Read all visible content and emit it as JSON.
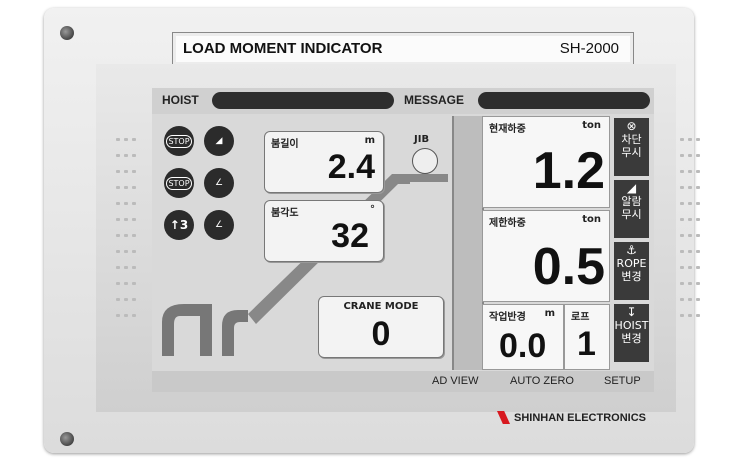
{
  "device": {
    "title": "LOAD MOMENT INDICATOR",
    "model": "SH-2000",
    "brand": "SHINHAN ELECTRONICS",
    "brand_color": "#d71920"
  },
  "topbar": {
    "hoist_label": "HOIST",
    "message_label": "MESSAGE"
  },
  "indicators": {
    "icons": [
      "stop-sign-icon",
      "boom-icon",
      "stop-overload-icon",
      "boom-angle-icon",
      "hook-up-icon",
      "boom-angle-down-icon"
    ],
    "stop_text": "STOP",
    "hook_text": "↑3"
  },
  "boom_length": {
    "label": "붐길이",
    "unit": "m",
    "value": "2.4"
  },
  "boom_angle": {
    "label": "붐각도",
    "unit": "°",
    "value": "32"
  },
  "jib": {
    "label": "JIB"
  },
  "crane_mode": {
    "label": "CRANE MODE",
    "value": "0"
  },
  "current_load": {
    "label": "현재하중",
    "unit": "ton",
    "value": "1.2"
  },
  "rated_load": {
    "label": "제한하중",
    "unit": "ton",
    "value": "0.5"
  },
  "working_radius": {
    "label": "작업반경",
    "unit": "m",
    "value": "0.0"
  },
  "rope": {
    "label": "로프",
    "value": "1"
  },
  "side_buttons": [
    {
      "label": "차단\n무시",
      "icon": "cut-off-icon"
    },
    {
      "label": "알람\n무시",
      "icon": "alarm-icon"
    },
    {
      "label": "ROPE\n변경",
      "icon": "rope-icon"
    },
    {
      "label": "HOIST\n변경",
      "icon": "hoist-icon"
    }
  ],
  "bottombar": {
    "ad_view": "AD VIEW",
    "auto_zero": "AUTO ZERO",
    "setup": "SETUP"
  }
}
